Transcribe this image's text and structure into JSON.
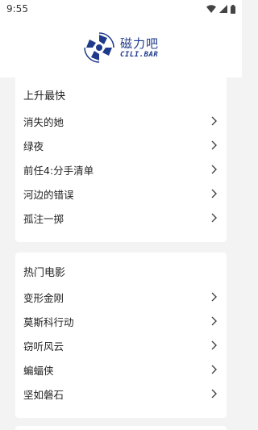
{
  "status_bar": {
    "time": "9:55"
  },
  "header": {
    "logo_cn": "磁力吧",
    "logo_en": "CILI.BAR"
  },
  "sections": [
    {
      "title": "上升最快",
      "items": [
        "消失的她",
        "绿夜",
        "前任4:分手清单",
        "河边的错误",
        "孤注一掷"
      ]
    },
    {
      "title": "热门电影",
      "items": [
        "变形金刚",
        "莫斯科行动",
        "窃听风云",
        "蝙蝠侠",
        "坚如磐石"
      ]
    }
  ],
  "colors": {
    "brand": "#1e3a8a",
    "background": "#f3f3f3",
    "card": "#ffffff"
  }
}
